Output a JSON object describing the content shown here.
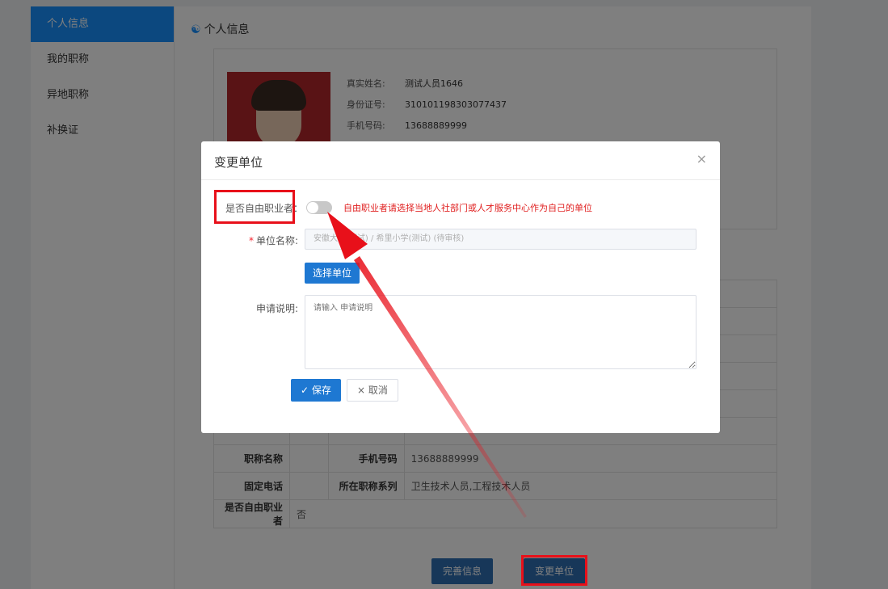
{
  "sidebar": {
    "items": [
      {
        "label": "个人信息",
        "active": true
      },
      {
        "label": "我的职称",
        "active": false
      },
      {
        "label": "异地职称",
        "active": false
      },
      {
        "label": "补换证",
        "active": false
      }
    ]
  },
  "main": {
    "section_title": "个人信息",
    "profile": {
      "real_name_label": "真实姓名:",
      "real_name": "测试人员1646",
      "id_label": "身份证号:",
      "id_number": "310101198303077437",
      "phone_label": "手机号码:",
      "phone": "13688889999"
    },
    "table_rows": [
      {
        "l1": "职称名称",
        "v1": "",
        "l2": "手机号码",
        "v2": "13688889999"
      },
      {
        "l1": "固定电话",
        "v1": "",
        "l2": "所在职称系列",
        "v2": "卫生技术人员,工程技术人员"
      },
      {
        "l1": "是否自由职业者",
        "v1": "否",
        "l2": "",
        "v2": ""
      }
    ],
    "complete_button": "完善信息",
    "change_unit_button": "变更单位"
  },
  "modal": {
    "title": "变更单位",
    "close_symbol": "×",
    "freelancer_label": "是否自由职业者：",
    "freelancer_on": false,
    "freelancer_hint": "自由职业者请选择当地人社部门或人才服务中心作为自己的单位",
    "unit_label": "单位名称:",
    "unit_required_mark": "*",
    "unit_value": "安徽大学(测试) / 希里小学(测试) (待审核)",
    "select_unit_button": "选择单位",
    "note_label": "申请说明:",
    "note_placeholder": "请输入 申请说明",
    "save_button": "保存",
    "save_icon": "✓",
    "cancel_button": "取消",
    "cancel_icon": "×"
  },
  "colors": {
    "primary": "#1e78d2",
    "annotation_red": "#e8101a",
    "hint_red": "#e02020"
  }
}
